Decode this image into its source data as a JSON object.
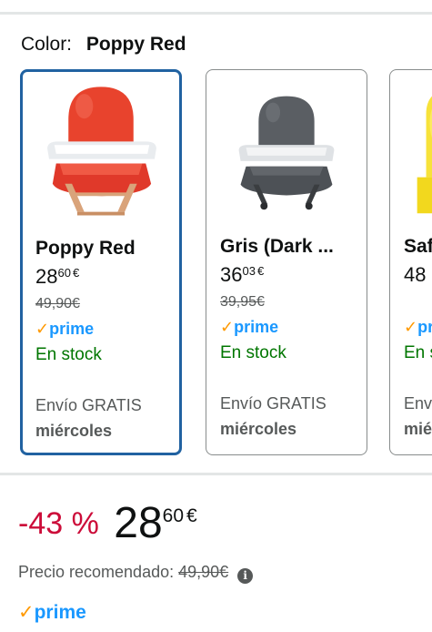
{
  "color": {
    "label": "Color:",
    "value": "Poppy Red"
  },
  "cards": [
    {
      "name": "Poppy Red",
      "price_whole": "28",
      "price_frac": "60",
      "currency": "€",
      "list_price": "49,90€",
      "prime": "prime",
      "prime_check": "✓",
      "stock": "En stock",
      "shipping": "Envío GRATIS",
      "shipping_day": "miércoles",
      "selected": true,
      "image": "red-booster-seat"
    },
    {
      "name": "Gris (Dark ...",
      "price_whole": "36",
      "price_frac": "03",
      "currency": "€",
      "list_price": "39,95€",
      "prime": "prime",
      "prime_check": "✓",
      "stock": "En stock",
      "shipping": "Envío GRATIS",
      "shipping_day": "miércoles",
      "selected": false,
      "image": "grey-booster-seat"
    },
    {
      "name": "Saf",
      "price_whole": "48",
      "price_frac": "",
      "currency": "",
      "list_price": "",
      "prime": "pri",
      "prime_check": "✓",
      "stock": "En s",
      "shipping": "Env",
      "shipping_day": "mié",
      "selected": false,
      "image": "yellow-booster-seat"
    }
  ],
  "deal": {
    "discount": "-43 %",
    "price_whole": "28",
    "price_frac": "60",
    "currency": "€"
  },
  "recommended": {
    "label": "Precio recomendado:",
    "price": "49,90€",
    "info_icon": "info-icon",
    "info_glyph": "i"
  },
  "bottom_prime": {
    "check": "✓",
    "label": "prime"
  },
  "colors": {
    "selected_border": "#2162a1",
    "prime_blue": "#1a98ff",
    "prime_check": "#ff9900",
    "stock_green": "#007600",
    "discount_red": "#cc0c39"
  }
}
